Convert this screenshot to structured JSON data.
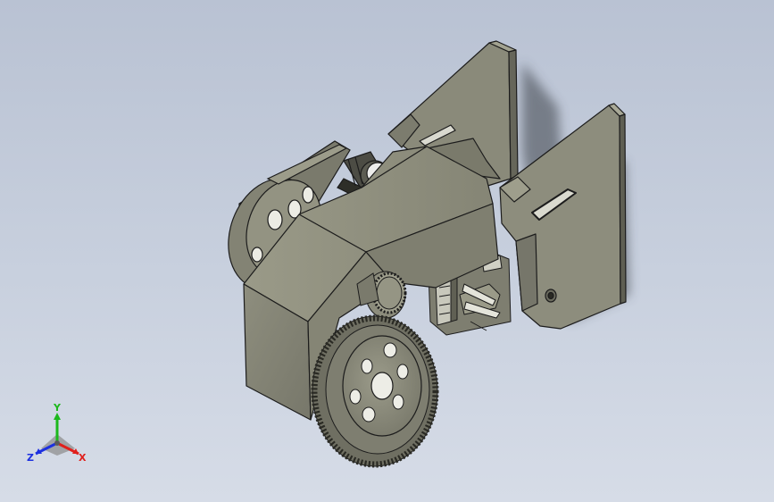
{
  "viewport": {
    "background_top": "#b9c2d3",
    "background_bottom": "#d6dce7",
    "model_color": "#8c8c7c",
    "model_shade": "#6e6e60",
    "model_light": "#a7a796",
    "edge_color": "#1c1c1c"
  },
  "triad": {
    "x_label": "X",
    "y_label": "Y",
    "z_label": "Z",
    "x_color": "#e0201c",
    "y_color": "#1cb81c",
    "z_color": "#1c30e0"
  }
}
